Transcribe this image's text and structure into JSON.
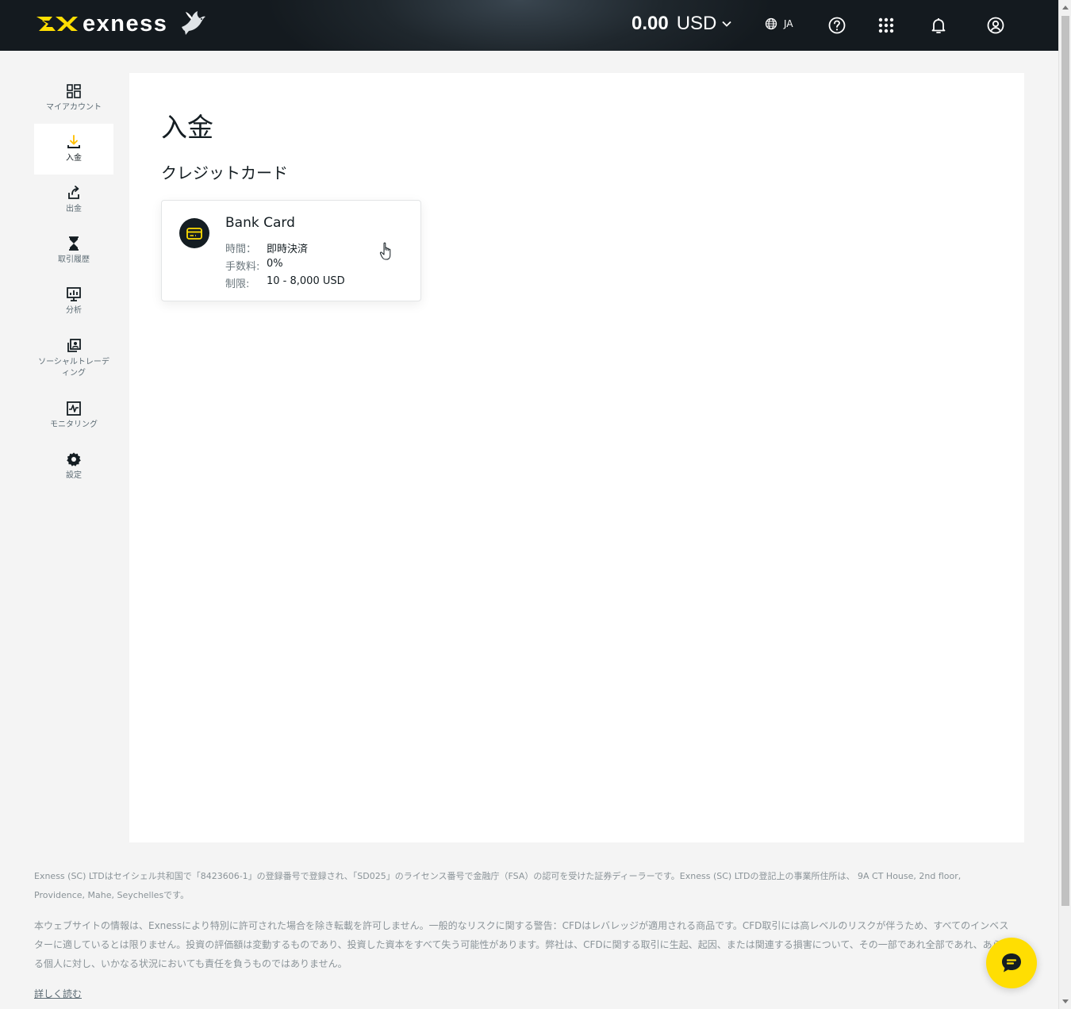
{
  "colors": {
    "brand_yellow": "#ffde02",
    "header_dark": "#1f272d",
    "text_dark": "#141d22",
    "text_muted": "#6b777d"
  },
  "header": {
    "brand_name": "exness",
    "balance_amount": "0.00",
    "balance_currency": "USD",
    "language": "JA",
    "icons": [
      "globe-icon",
      "help-icon",
      "apps-grid-icon",
      "bell-icon",
      "user-account-icon"
    ]
  },
  "sidebar": {
    "items": [
      {
        "label": "マイアカウント",
        "icon": "dashboard-icon"
      },
      {
        "label": "入金",
        "icon": "deposit-icon",
        "active": true
      },
      {
        "label": "出金",
        "icon": "withdrawal-icon"
      },
      {
        "label": "取引履歴",
        "icon": "hourglass-icon"
      },
      {
        "label": "分析",
        "icon": "analytics-icon"
      },
      {
        "label": "ソーシャルトレーディング",
        "icon": "social-trading-icon"
      },
      {
        "label": "モニタリング",
        "icon": "monitoring-icon"
      },
      {
        "label": "設定",
        "icon": "gear-icon"
      }
    ]
  },
  "main": {
    "title": "入金",
    "section_title": "クレジットカード",
    "payment_card": {
      "name": "Bank Card",
      "icon": "credit-card-icon",
      "time_label": "時間：",
      "time_value": "即時決済",
      "fee_label": "手数料:",
      "fee_value": "0%",
      "limit_label": "制限:",
      "limit_value": "10 - 8,000 USD"
    }
  },
  "footer": {
    "paragraph1": "Exness (SC) LTDはセイシェル共和国で「8423606-1」の登録番号で登録され、「SD025」のライセンス番号で金融庁（FSA）の認可を受けた証券ディーラーです。Exness (SC) LTDの登記上の事業所住所は、 9A CT House, 2nd floor, Providence, Mahe, Seychellesです。",
    "paragraph2": "本ウェブサイトの情報は、Exnessにより特別に許可された場合を除き転載を許可しません。一般的なリスクに関する警告：CFDはレバレッジが適用される商品です。CFD取引には高レベルのリスクが伴うため、すべてのインベスターに適しているとは限りません。投資の評価額は変動するものであり、投資した資本をすべて失う可能性があります。弊社は、CFDに関する取引に生起、起因、または関連する損害について、その一部であれ全部であれ、あらゆる個人に対し、いかなる状況においても責任を負うものではありません。",
    "read_more": "詳しく読む"
  },
  "chat": {
    "icon": "chat-icon"
  }
}
